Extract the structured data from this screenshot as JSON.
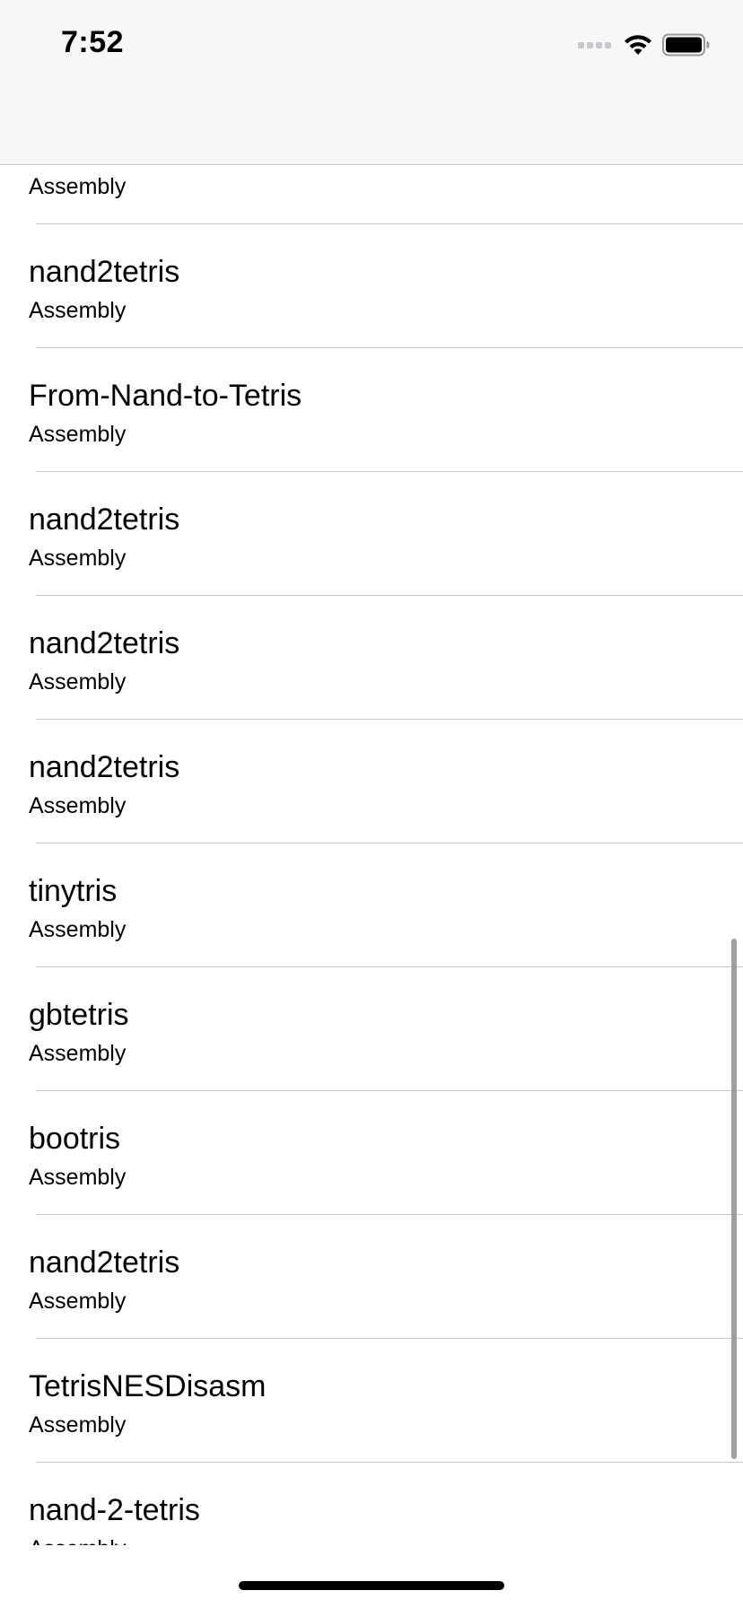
{
  "status_bar": {
    "time": "7:52",
    "icons": [
      "cellular-signal-icon",
      "wifi-icon",
      "battery-icon"
    ]
  },
  "repositories": [
    {
      "name": "",
      "language": "Assembly"
    },
    {
      "name": "nand2tetris",
      "language": "Assembly"
    },
    {
      "name": "From-Nand-to-Tetris",
      "language": "Assembly"
    },
    {
      "name": "nand2tetris",
      "language": "Assembly"
    },
    {
      "name": "nand2tetris",
      "language": "Assembly"
    },
    {
      "name": "nand2tetris",
      "language": "Assembly"
    },
    {
      "name": "tinytris",
      "language": "Assembly"
    },
    {
      "name": "gbtetris",
      "language": "Assembly"
    },
    {
      "name": "bootris",
      "language": "Assembly"
    },
    {
      "name": "nand2tetris",
      "language": "Assembly"
    },
    {
      "name": "TetrisNESDisasm",
      "language": "Assembly"
    },
    {
      "name": "nand-2-tetris",
      "language": "Assembly"
    }
  ],
  "colors": {
    "nav_background": "#f7f7f7",
    "separator": "#c8c8cc",
    "text": "#000000"
  }
}
